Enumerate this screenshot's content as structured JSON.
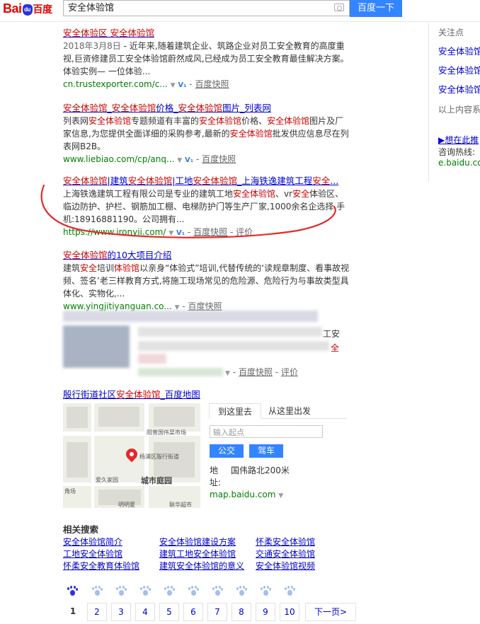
{
  "header": {
    "logo_text_1": "Bai",
    "logo_paw": "du",
    "logo_text_2": "百度",
    "search_query": "安全体验馆",
    "search_button": "百度一下"
  },
  "results": [
    {
      "title_parts": [
        "安全体验区 安全体验馆"
      ],
      "date": "2018年3月8日",
      "abstract": " - 近年来,随着建筑企业、筑路企业对员工安全教育的高度重视,巨资修建员工安全体验馆蔚然成风,已经成为员工安全教育最佳解决方案。体验实例— 一位体验...",
      "url": "cn.trustexporter.com/c...",
      "snapshot": "百度快照"
    },
    {
      "title": "安全体验馆_安全体验馆价格_安全体验馆图片_列表网",
      "abstract": "列表网安全体验馆专题频道有丰富的安全体验馆价格、安全体验馆图片及厂家信息,为您提供全面详细的采购参考,最新的安全体验馆批发供应信息尽在列表网B2B。",
      "url": "www.liebiao.com/cp/anq...",
      "snapshot": "百度快照"
    },
    {
      "title": "安全体验馆|建筑安全体验馆|工地安全体验馆_上海铁逸建筑工程安全...",
      "abstract": "上海铁逸建筑工程有限公司是专业的建筑工地安全体验馆、vr安全体验区、临边防护、护栏、钢筋加工棚、电梯防护门等生产厂家,1000余名企选择.手机:18916881190。公司拥有...",
      "url": "https://www.ironyii.com/",
      "snapshot": "百度快照",
      "review": "评价"
    },
    {
      "title": "安全体验馆的10大项目介绍",
      "abstract": "建筑安全培训体验馆以亲身“体验式”培训,代替传统的‘读规章制度、看事故视频、签名’老三样教育方式,将施工现场常见的危险源、危险行为与事故类型具体化、实物化,...",
      "url": "www.yingjitiyanguan.co...",
      "snapshot": "百度快照"
    }
  ],
  "blurred_result": {
    "snapshot": "百度快照",
    "review": "评价",
    "partial_text_1": "工安",
    "partial_text_2": "全"
  },
  "right_col": {
    "title": "关注点",
    "links": [
      "安全体验馆",
      "安全体验馆",
      "安全体验馆"
    ],
    "info": "以上内容系",
    "ad_link": "▶想在此推",
    "hotline": "咨询热线:",
    "site": "e.baidu.com"
  },
  "map_card": {
    "title_pre": "殷行街道社区",
    "title_em": "安全体验馆",
    "title_post": "_百度地图",
    "tab_to": "到这里去",
    "tab_from": "从这里出发",
    "start_placeholder": "输入起点",
    "btn_bus": "公交",
    "btn_car": "驾车",
    "addr_label": "地址:",
    "addr_value": "国伟路北200米",
    "url": "map.baidu.com",
    "map_labels": [
      "阳普国伟菜市场",
      "杨浦区殷行街道",
      "城市庭园",
      "爱久家园",
      "角场",
      "明明夏",
      "联华超市"
    ]
  },
  "related": {
    "title": "相关搜索",
    "links": [
      "安全体验馆简介",
      "安全体验馆建设方案",
      "怀柔安全体验馆",
      "工地安全体验馆",
      "建筑工地安全体验馆",
      "交通安全体验馆",
      "怀柔安全教育体验馆",
      "建筑安全体验馆的意义",
      "安全体验馆视频"
    ]
  },
  "pager": {
    "current": "1",
    "pages": [
      "2",
      "3",
      "4",
      "5",
      "6",
      "7",
      "8",
      "9",
      "10"
    ],
    "next": "下一页>"
  },
  "colors": {
    "link": "#0000cc",
    "highlight": "#cc0000",
    "url": "#008000",
    "button": "#3385ff",
    "annotation": "#e52a2a"
  }
}
